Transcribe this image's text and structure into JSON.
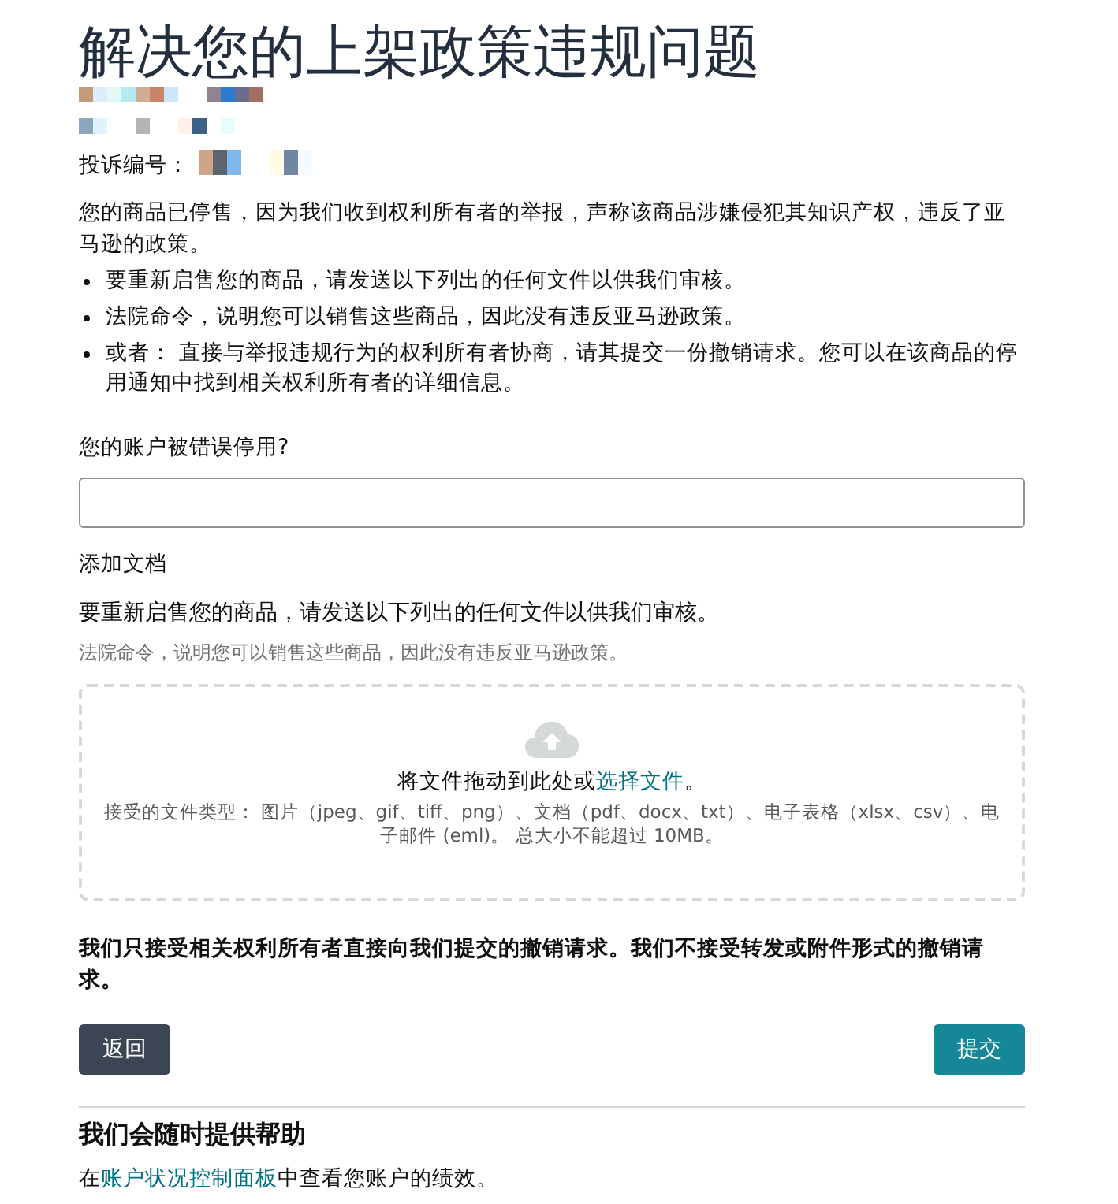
{
  "title": "解决您的上架政策违规问题",
  "complaint": {
    "label": "投诉编号："
  },
  "intro": "您的商品已停售，因为我们收到权利所有者的举报，声称该商品涉嫌侵犯其知识产权，违反了亚马逊的政策。",
  "bullets": [
    {
      "text": "要重新启售您的商品，请发送以下列出的任何文件以供我们审核。"
    },
    {
      "text": "法院命令，说明您可以销售这些商品，因此没有违反亚马逊政策。"
    },
    {
      "text": "或者： 直接与举报违规行为的权利所有者协商，请其提交一份撤销请求。您可以在该商品的停用通知中找到相关权利所有者的详细信息。"
    }
  ],
  "question": {
    "label": "您的账户被错误停用?"
  },
  "documents": {
    "label": "添加文档",
    "instruction": "要重新启售您的商品，请发送以下列出的任何文件以供我们审核。",
    "hint": "法院命令，说明您可以销售这些商品，因此没有违反亚马逊政策。",
    "dropzone": {
      "prompt_before": "将文件拖动到此处或",
      "link": "选择文件",
      "prompt_after": "。",
      "accepted": "接受的文件类型： 图片（jpeg、gif、tiff、png）、文档（pdf、docx、txt）、电子表格（xlsx、csv）、电子邮件 (eml)。 总大小不能超过 10MB。"
    }
  },
  "notice": "我们只接受相关权利所有者直接向我们提交的撤销请求。我们不接受转发或附件形式的撤销请求。",
  "buttons": [
    {
      "label": "返回",
      "kind": "secondary"
    },
    {
      "label": "提交",
      "kind": "primary"
    }
  ],
  "help": {
    "title": "我们会随时提供帮助",
    "text_before": "在",
    "link": "账户状况控制面板",
    "text_after": "中查看您账户的绩效。"
  }
}
